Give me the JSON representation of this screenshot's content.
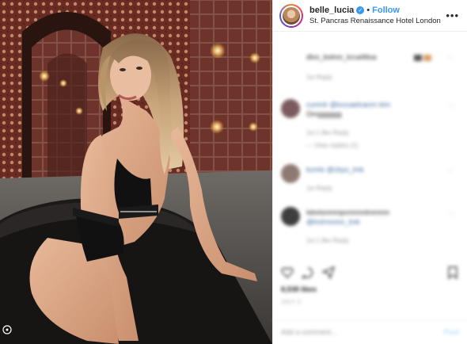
{
  "header": {
    "username": "belle_lucia",
    "separator": "•",
    "follow_label": "Follow",
    "location": "St. Pancras Renaissance Hotel London",
    "more_label": "•••"
  },
  "comments": [
    {
      "text": "dlvo_bolmn_lcruellitsa",
      "meta": "1w   Reply",
      "avatar_color": "#d9c8c2",
      "has_avatar": false
    },
    {
      "text": "cumnlr  @luvuaelvanrn  kim",
      "text2": "Omgggggg",
      "meta": "1w   1 like   Reply",
      "meta2": "—  View replies (1)",
      "avatar_color": "#7b5a5e",
      "has_avatar": true
    },
    {
      "text": "kvmls  @cbyo_lmk",
      "meta": "1w   Reply",
      "avatar_color": "#8e7a72",
      "has_avatar": true
    },
    {
      "text": "lsbvtsnmmpvnmnntmmmn",
      "text2": "@lmlrmnmn_lmk",
      "meta": "1w   1 like   Reply",
      "avatar_color": "#3e3e3e",
      "has_avatar": true
    }
  ],
  "actions": {
    "like_icon": "heart-icon",
    "comment_icon": "comment-icon",
    "share_icon": "share-icon",
    "save_icon": "bookmark-icon"
  },
  "likes_text": "8,538 likes",
  "date_text": "JULY 2",
  "add_comment_placeholder": "Add a comment...",
  "post_label": "Post",
  "colors": {
    "accent": "#3897f0",
    "verified": "#3897f0",
    "muted": "#999999"
  }
}
